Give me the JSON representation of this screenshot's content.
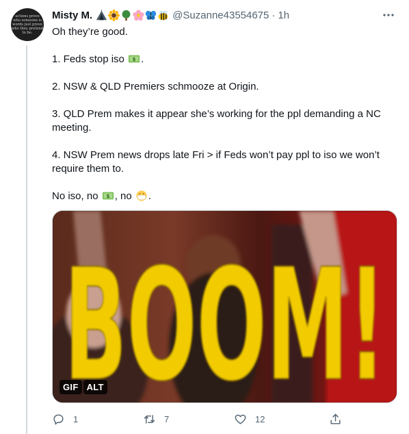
{
  "tweet": {
    "avatar_lines": [
      "actions prove",
      "who someone is",
      "words just prove",
      "who they pretend",
      "to be."
    ],
    "author_name": "Misty M.",
    "handle": "@Suzanne43554675",
    "separator": "·",
    "time": "1h",
    "name_emojis": [
      "tent-emoji",
      "sunflower-emoji",
      "tree-emoji",
      "blossom-emoji",
      "butterfly-emoji",
      "bee-emoji"
    ],
    "text": {
      "line1": "Oh they’re good.",
      "p1_before": "1. Feds stop iso ",
      "p1_after": ".",
      "p2": "2. NSW & QLD Premiers schmooze at Origin.",
      "p3": "3. QLD Prem makes it appear she’s working for the ppl demanding a NC meeting.",
      "p4": "4. NSW Prem news drops late Fri > if Feds won’t pay ppl to iso we won’t require them to.",
      "p5_a": "No iso, no ",
      "p5_b": ", no ",
      "p5_c": "."
    },
    "media": {
      "gif_text": "BOOM!",
      "badge_gif": "GIF",
      "badge_alt": "ALT"
    },
    "actions": {
      "reply_count": "1",
      "retweet_count": "7",
      "like_count": "12"
    }
  },
  "colors": {
    "text": "#0f1419",
    "muted": "#536471",
    "border": "#cfd9de",
    "gif_text": "#f2cc00"
  }
}
